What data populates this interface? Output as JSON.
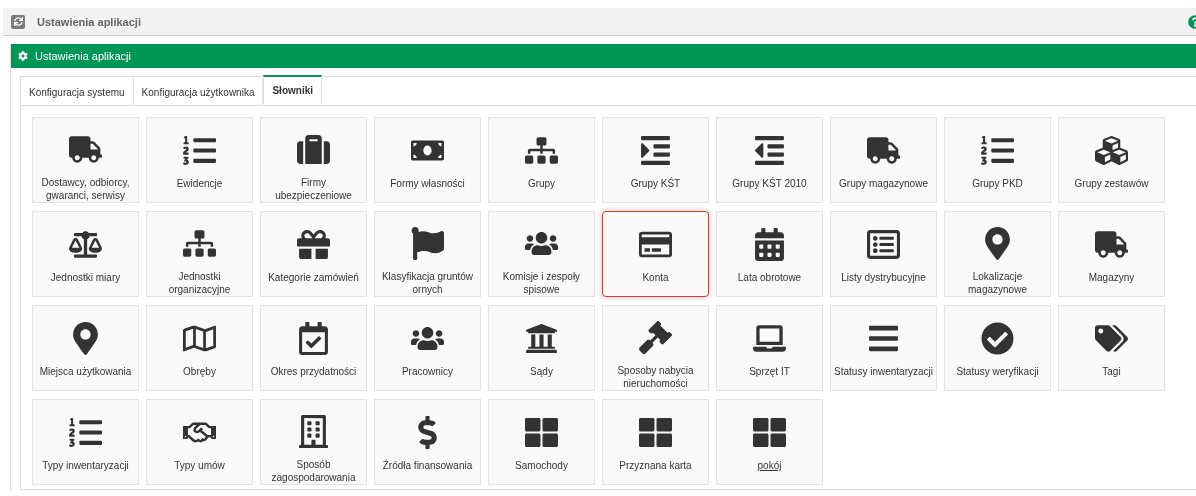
{
  "top_bar": {
    "title": "Ustawienia aplikacji"
  },
  "panel": {
    "title": "Ustawienia aplikacji"
  },
  "tabs": [
    {
      "label": "Konfiguracja systemu",
      "selected": false
    },
    {
      "label": "Konfiguracja użytkownika",
      "selected": false
    },
    {
      "label": "Słowniki",
      "selected": true
    }
  ],
  "tiles": [
    {
      "label": "Dostawcy, odbiorcy, gwaranci, serwisy",
      "selected": false,
      "hovered": false
    },
    {
      "label": "Ewidencje",
      "selected": false,
      "hovered": false
    },
    {
      "label": "Firmy ubezpieczeniowe",
      "selected": false,
      "hovered": false
    },
    {
      "label": "Formy własności",
      "selected": false,
      "hovered": false
    },
    {
      "label": "Grupy",
      "selected": false,
      "hovered": false
    },
    {
      "label": "Grupy KŚT",
      "selected": false,
      "hovered": false
    },
    {
      "label": "Grupy KŚT 2010",
      "selected": false,
      "hovered": false
    },
    {
      "label": "Grupy magazynowe",
      "selected": false,
      "hovered": false
    },
    {
      "label": "Grupy PKD",
      "selected": false,
      "hovered": false
    },
    {
      "label": "Grupy zestawów",
      "selected": false,
      "hovered": false
    },
    {
      "label": "Jednostki miary",
      "selected": false,
      "hovered": false
    },
    {
      "label": "Jednostki organizacyjne",
      "selected": false,
      "hovered": false
    },
    {
      "label": "Kategorie zamówień",
      "selected": false,
      "hovered": false
    },
    {
      "label": "Klasyfikacja gruntów ornych",
      "selected": false,
      "hovered": false
    },
    {
      "label": "Komisje i zespoły spisowe",
      "selected": false,
      "hovered": false
    },
    {
      "label": "Konta",
      "selected": true,
      "hovered": false
    },
    {
      "label": "Lata obrotowe",
      "selected": false,
      "hovered": false
    },
    {
      "label": "Listy dystrybucyjne",
      "selected": false,
      "hovered": false
    },
    {
      "label": "Lokalizacje magazynowe",
      "selected": false,
      "hovered": false
    },
    {
      "label": "Magazyny",
      "selected": false,
      "hovered": false
    },
    {
      "label": "Miejsca użytkowania",
      "selected": false,
      "hovered": false
    },
    {
      "label": "Obręby",
      "selected": false,
      "hovered": false
    },
    {
      "label": "Okres przydatności",
      "selected": false,
      "hovered": false
    },
    {
      "label": "Pracownicy",
      "selected": false,
      "hovered": false
    },
    {
      "label": "Sądy",
      "selected": false,
      "hovered": false
    },
    {
      "label": "Sposoby nabycia nieruchomości",
      "selected": false,
      "hovered": false
    },
    {
      "label": "Sprzęt IT",
      "selected": false,
      "hovered": false
    },
    {
      "label": "Statusy inwentaryzacji",
      "selected": false,
      "hovered": false
    },
    {
      "label": "Statusy weryfikacji",
      "selected": false,
      "hovered": false
    },
    {
      "label": "Tagi",
      "selected": false,
      "hovered": false
    },
    {
      "label": "Typy inwentaryzacji",
      "selected": false,
      "hovered": false
    },
    {
      "label": "Typy umów",
      "selected": false,
      "hovered": false
    },
    {
      "label": "Sposób zagospodarowania",
      "selected": false,
      "hovered": false
    },
    {
      "label": "Źródła finansowania",
      "selected": false,
      "hovered": false
    },
    {
      "label": "Samochody",
      "selected": false,
      "hovered": false
    },
    {
      "label": "Przyznana karta",
      "selected": false,
      "hovered": false
    },
    {
      "label": "pokój",
      "selected": false,
      "hovered": true
    }
  ]
}
